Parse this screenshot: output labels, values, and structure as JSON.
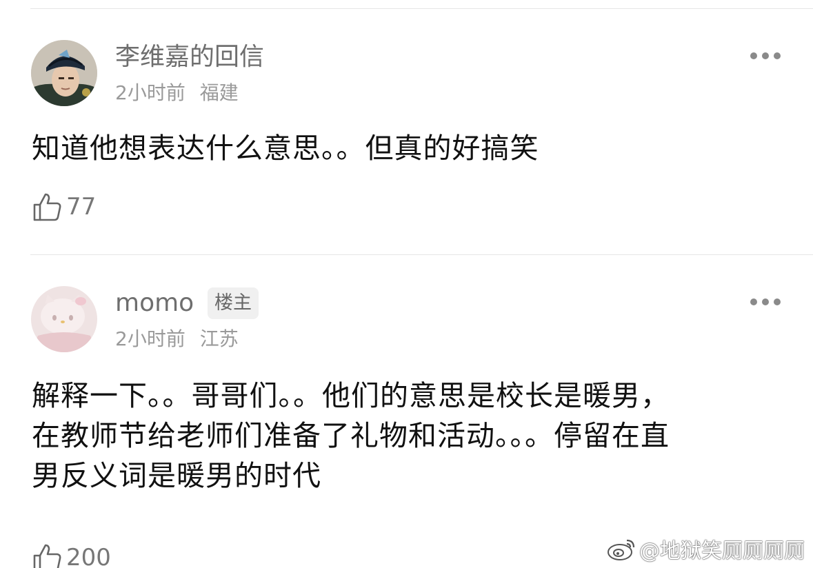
{
  "comments": [
    {
      "username": "李维嘉的回信",
      "time": "2小时前",
      "location": "福建",
      "content": "知道他想表达什么意思。。但真的好搞笑",
      "likes": "77",
      "avatar_icon": "user-avatar-man-in-cap"
    },
    {
      "username": "momo",
      "badge": "楼主",
      "time": "2小时前",
      "location": "江苏",
      "content_lines": [
        "解释一下。。哥哥们。。他们的意思是校长是暖男，",
        "在教师节给老师们准备了礼物和活动。。。停留在直",
        "男反义词是暖男的时代"
      ],
      "likes": "200",
      "avatar_icon": "user-avatar-hello-kitty"
    }
  ],
  "icons": {
    "more": "more-dots-icon",
    "like": "thumbs-up-icon",
    "weibo": "weibo-logo-icon"
  },
  "watermark": "@地狱笑厕厕厕厕"
}
